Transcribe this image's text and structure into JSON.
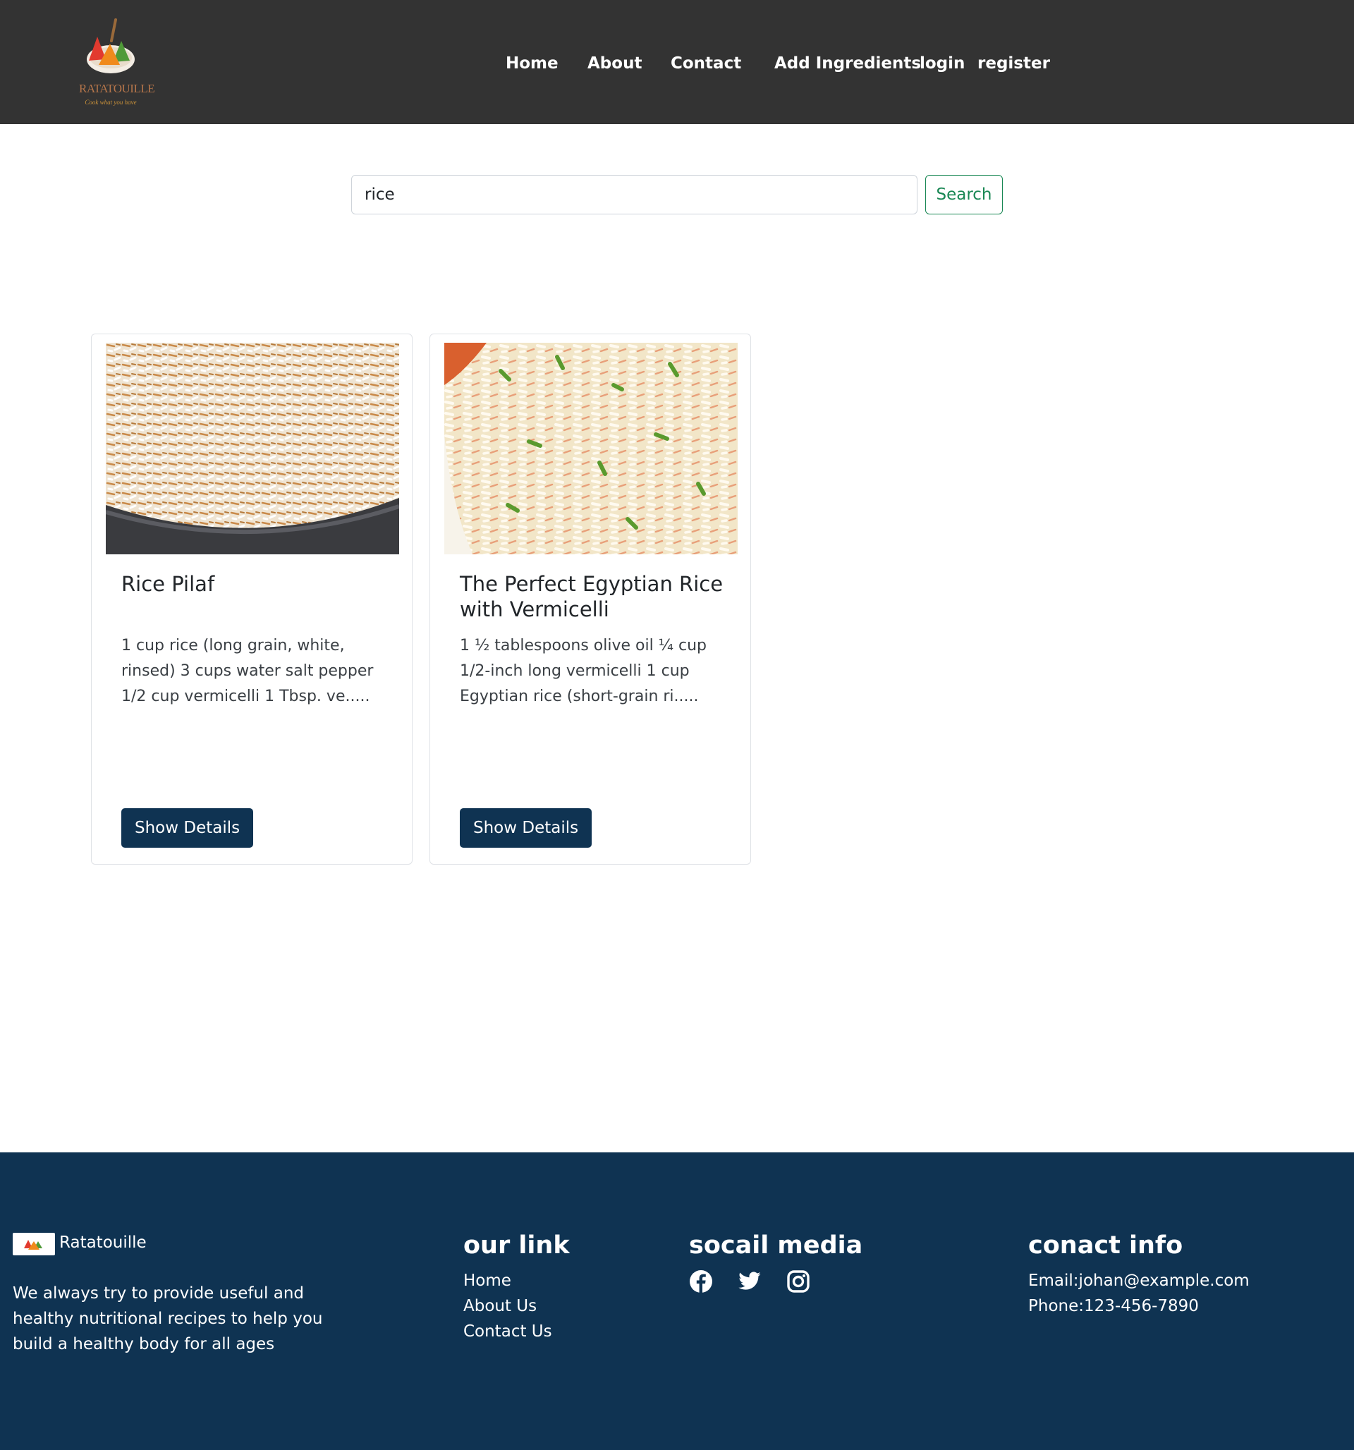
{
  "header": {
    "logo_text": "RATATOUILLE",
    "logo_tagline": "Cook what you have",
    "nav": {
      "home": "Home",
      "about": "About",
      "contact": "Contact",
      "add_ingredients": "Add Ingredients",
      "login": "login",
      "register": "register"
    }
  },
  "search": {
    "value": "rice",
    "button_label": "Search"
  },
  "recipes": [
    {
      "title": "Rice Pilaf",
      "excerpt": "1 cup rice (long grain, white, rinsed) 3 cups water salt pepper 1/2 cup vermicelli 1 Tbsp. ve.....",
      "button_label": "Show Details"
    },
    {
      "title": "The Perfect Egyptian Rice with Vermicelli",
      "excerpt": "1 ½ tablespoons olive oil ¼ cup 1/2-inch long vermicelli 1 cup Egyptian rice (short-grain ri.....",
      "button_label": "Show Details"
    }
  ],
  "footer": {
    "brand": "Ratatouille",
    "description": "We always try to provide useful and healthy nutritional recipes to help you build a healthy body for all ages",
    "links_heading": "our link",
    "links": [
      "Home",
      "About Us",
      "Contact Us"
    ],
    "social_heading": "socail media",
    "social_icons": [
      "facebook-icon",
      "twitter-icon",
      "instagram-icon"
    ],
    "contact_heading": "conact info",
    "email": "Email:johan@example.com",
    "phone": "Phone:123-456-7890"
  },
  "colors": {
    "navbar_bg": "#333333",
    "footer_bg": "#0f3352",
    "primary_button": "#0f3352",
    "search_outline": "#198754"
  }
}
